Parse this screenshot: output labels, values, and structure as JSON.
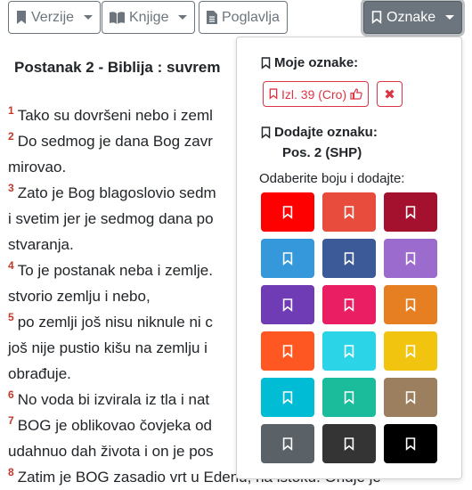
{
  "toolbar": {
    "versions_label": "Verzije",
    "books_label": "Knjige",
    "chapters_label": "Poglavlja",
    "bookmarks_label": "Oznake"
  },
  "page": {
    "title": "Postanak 2 - Biblija : suvrem"
  },
  "verses": [
    {
      "num": "1",
      "lines": [
        "Tako su dovršeni nebo i zeml"
      ]
    },
    {
      "num": "2",
      "lines": [
        "Do sedmog je dana Bog zavr",
        "mirovao."
      ]
    },
    {
      "num": "3",
      "lines": [
        "Zato je Bog blagoslovio sedm",
        "i svetim jer je sedmog dana po",
        "stvaranja."
      ]
    },
    {
      "num": "4",
      "lines": [
        "To je postanak neba i zemlje.",
        "stvorio zemlju i nebo,"
      ]
    },
    {
      "num": "5",
      "lines": [
        "po zemlji još nisu niknule ni c",
        "još nije pustio kišu na zemlju i",
        "obrađuje."
      ]
    },
    {
      "num": "6",
      "lines": [
        "No voda bi izvirala iz tla i nat"
      ]
    },
    {
      "num": "7",
      "lines": [
        "BOG je oblikovao čovjeka od",
        "udahnuo dah života i on je pos"
      ]
    },
    {
      "num": "8",
      "lines": [
        "Zatim je BOG zasadio vrt u Edenu, na istoku. Ondje je"
      ]
    }
  ],
  "dropdown": {
    "my_bookmarks_heading": "Moje oznake:",
    "saved_bookmark_label": "Izl. 39 (Cro)",
    "add_bookmark_heading": "Dodajte oznaku:",
    "add_bookmark_ref": "Pos. 2 (SHP)",
    "choose_color_label": "Odaberite boju i dodajte:",
    "accent_color": "#dc3545",
    "swatch_colors": [
      "#ff0000",
      "#e74c3c",
      "#a3112e",
      "#3498db",
      "#3d5a98",
      "#9b6bce",
      "#6f3cb5",
      "#e91e63",
      "#e67e22",
      "#ff5722",
      "#2bd4e6",
      "#f1c40f",
      "#00bcd4",
      "#1abc9c",
      "#9c7f5f",
      "#5a6268",
      "#343434",
      "#000000"
    ]
  },
  "icons": {
    "toolbar_versions": "bookmark-icon",
    "toolbar_books": "book-icon",
    "toolbar_chapters": "document-icon",
    "toolbar_bookmarks": "bookmark-outline-icon",
    "chip_action": "thumbs-up-icon",
    "delete": "close-icon"
  }
}
